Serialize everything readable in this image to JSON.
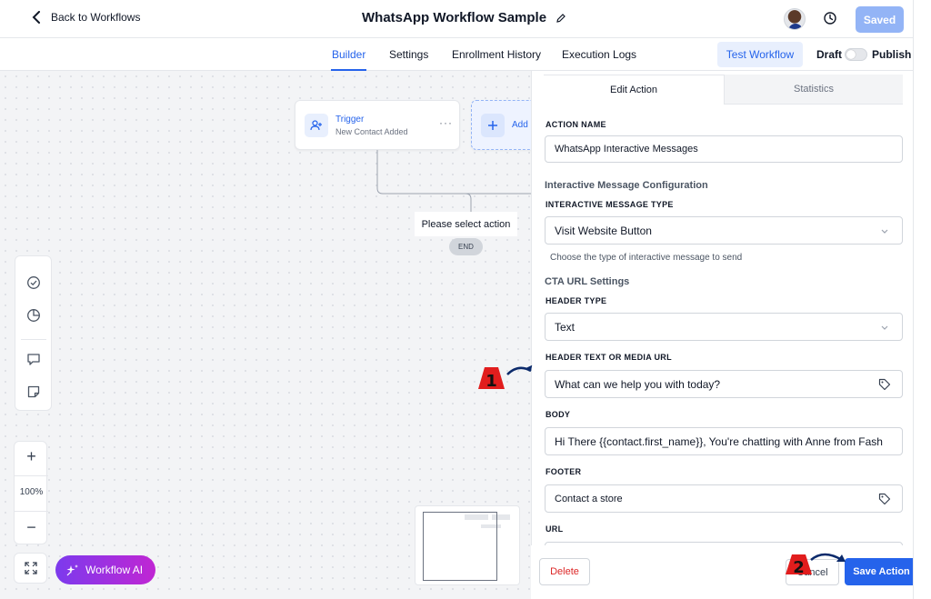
{
  "header": {
    "back_label": "Back to Workflows",
    "title": "WhatsApp Workflow Sample",
    "saved_label": "Saved"
  },
  "tabs": [
    {
      "label": "Builder",
      "active": true
    },
    {
      "label": "Settings",
      "active": false
    },
    {
      "label": "Enrollment History",
      "active": false
    },
    {
      "label": "Execution Logs",
      "active": false
    }
  ],
  "toolbar": {
    "test_label": "Test Workflow",
    "draft_label": "Draft",
    "publish_label": "Publish"
  },
  "canvas": {
    "trigger": {
      "title": "Trigger",
      "subtitle": "New Contact Added",
      "menu": "···"
    },
    "add_node_label": "Add",
    "select_action_label": "Please select action",
    "end_label": "END",
    "zoom": {
      "plus": "+",
      "level": "100%",
      "minus": "−"
    },
    "ai_label": "Workflow AI"
  },
  "panel": {
    "tab_edit": "Edit Action",
    "tab_stats": "Statistics",
    "action_name_label": "ACTION NAME",
    "action_name_value": "WhatsApp Interactive Messages",
    "config_section": "Interactive Message Configuration",
    "type_label": "INTERACTIVE MESSAGE TYPE",
    "type_value": "Visit Website Button",
    "type_helper": "Choose the type of interactive message to send",
    "cta_section": "CTA URL Settings",
    "header_type_label": "HEADER TYPE",
    "header_type_value": "Text",
    "header_text_label": "HEADER TEXT OR MEDIA URL",
    "header_text_value": "What can we help you with today?",
    "body_label": "BODY",
    "body_value": "Hi There {{contact.first_name}}, You're chatting with Anne from Fash",
    "footer_label": "FOOTER",
    "footer_value": "Contact a store",
    "url_label": "URL",
    "delete_label": "Delete",
    "cancel_label": "Cancel",
    "save_label": "Save Action"
  },
  "annotations": {
    "marker1": "1",
    "marker2": "2"
  },
  "colors": {
    "accent": "#2563eb",
    "ai_gradient_start": "#7c3aed",
    "ai_gradient_end": "#c026d3",
    "danger": "#dc2626",
    "marker": "#e11d1d"
  }
}
